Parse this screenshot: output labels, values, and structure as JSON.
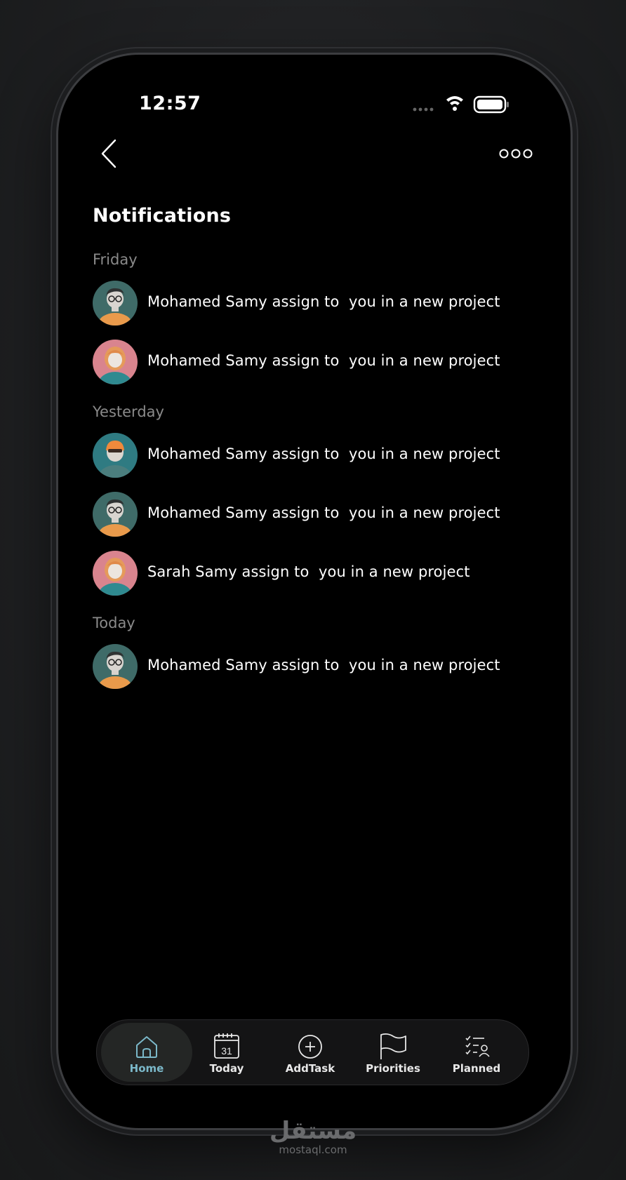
{
  "status_bar": {
    "time": "12:57"
  },
  "header": {
    "title": "Notifications"
  },
  "sections": [
    {
      "label": "Friday",
      "items": [
        {
          "text": "Mohamed Samy assign to  you in a new project",
          "avatar": "male-avatar"
        },
        {
          "text": "Mohamed Samy assign to  you in a new project",
          "avatar": "female-avatar"
        }
      ]
    },
    {
      "label": "Yesterday",
      "items": [
        {
          "text": "Mohamed Samy assign to  you in a new project",
          "avatar": "cap-avatar"
        },
        {
          "text": "Mohamed Samy assign to  you in a new project",
          "avatar": "male-avatar"
        },
        {
          "text": "Sarah Samy assign to  you in a new project",
          "avatar": "female-avatar"
        }
      ]
    },
    {
      "label": "Today",
      "items": [
        {
          "text": "Mohamed Samy assign to  you in a new project",
          "avatar": "male-avatar"
        }
      ]
    }
  ],
  "nav": {
    "items": [
      {
        "label": "Home",
        "icon": "home-icon",
        "active": true
      },
      {
        "label": "Today",
        "icon": "calendar-icon",
        "calendar_day": "31"
      },
      {
        "label": "AddTask",
        "icon": "add-circle-icon"
      },
      {
        "label": "Priorities",
        "icon": "flag-icon"
      },
      {
        "label": "Planned",
        "icon": "checklist-user-icon"
      }
    ]
  },
  "watermark": {
    "arabic": "مستقل",
    "latin": "mostaql.com"
  },
  "colors": {
    "background": "#000000",
    "accent": "#7bb8c9",
    "muted": "#8a8a8a"
  }
}
